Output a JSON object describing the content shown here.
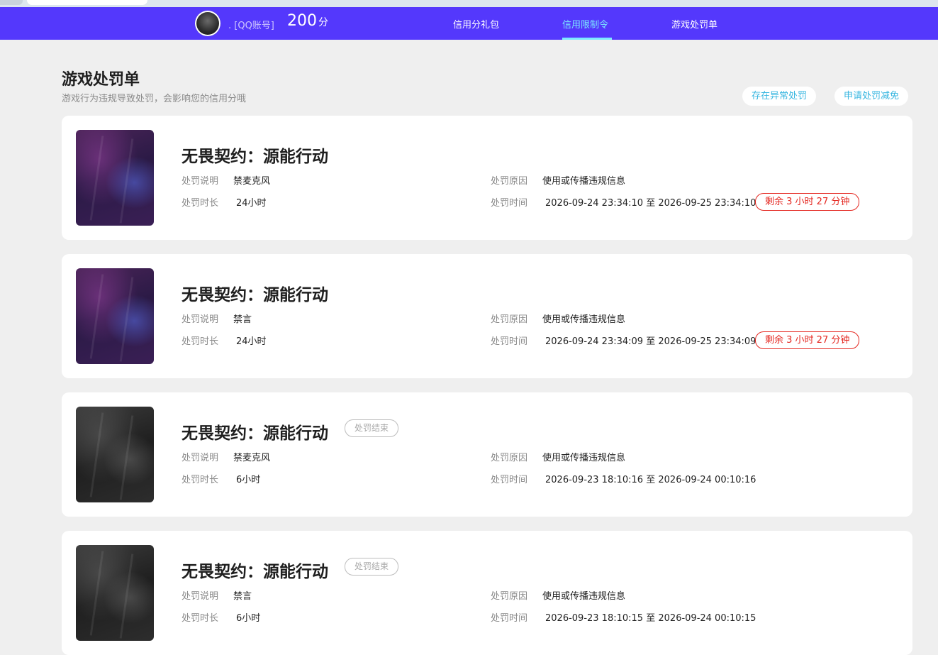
{
  "header": {
    "username": ". [QQ账号]",
    "score_value": "200",
    "score_unit": "分",
    "tabs": [
      {
        "label": "信用分礼包",
        "active": false
      },
      {
        "label": "信用限制令",
        "active": true
      },
      {
        "label": "游戏处罚单",
        "active": false
      }
    ],
    "accent_color": "#5438fc",
    "active_color": "#7ce9ff"
  },
  "page": {
    "title": "游戏处罚单",
    "subtitle": "游戏行为违规导致处罚，会影响您的信用分哦",
    "buttons": {
      "abnormal": "存在异常处罚",
      "appeal": "申请处罚减免"
    }
  },
  "labels": {
    "desc": "处罚说明",
    "duration": "处罚时长",
    "reason": "处罚原因",
    "time": "处罚时间",
    "time_sep": "至"
  },
  "penalties": [
    {
      "game": "无畏契约：源能行动",
      "status": "",
      "desc": "禁麦克风",
      "duration": "24小时",
      "reason": "使用或传播违规信息",
      "start": "2026-09-24 23:34:10",
      "end": "2026-09-25 23:34:10",
      "remaining": "剩余 3 小时 27 分钟"
    },
    {
      "game": "无畏契约：源能行动",
      "status": "",
      "desc": "禁言",
      "duration": "24小时",
      "reason": "使用或传播违规信息",
      "start": "2026-09-24 23:34:09",
      "end": "2026-09-25 23:34:09",
      "remaining": "剩余 3 小时 27 分钟"
    },
    {
      "game": "无畏契约：源能行动",
      "status": "处罚结束",
      "desc": "禁麦克风",
      "duration": "6小时",
      "reason": "使用或传播违规信息",
      "start": "2026-09-23 18:10:16",
      "end": "2026-09-24 00:10:16",
      "remaining": ""
    },
    {
      "game": "无畏契约：源能行动",
      "status": "处罚结束",
      "desc": "禁言",
      "duration": "6小时",
      "reason": "使用或传播违规信息",
      "start": "2026-09-23 18:10:15",
      "end": "2026-09-24 00:10:15",
      "remaining": ""
    }
  ]
}
